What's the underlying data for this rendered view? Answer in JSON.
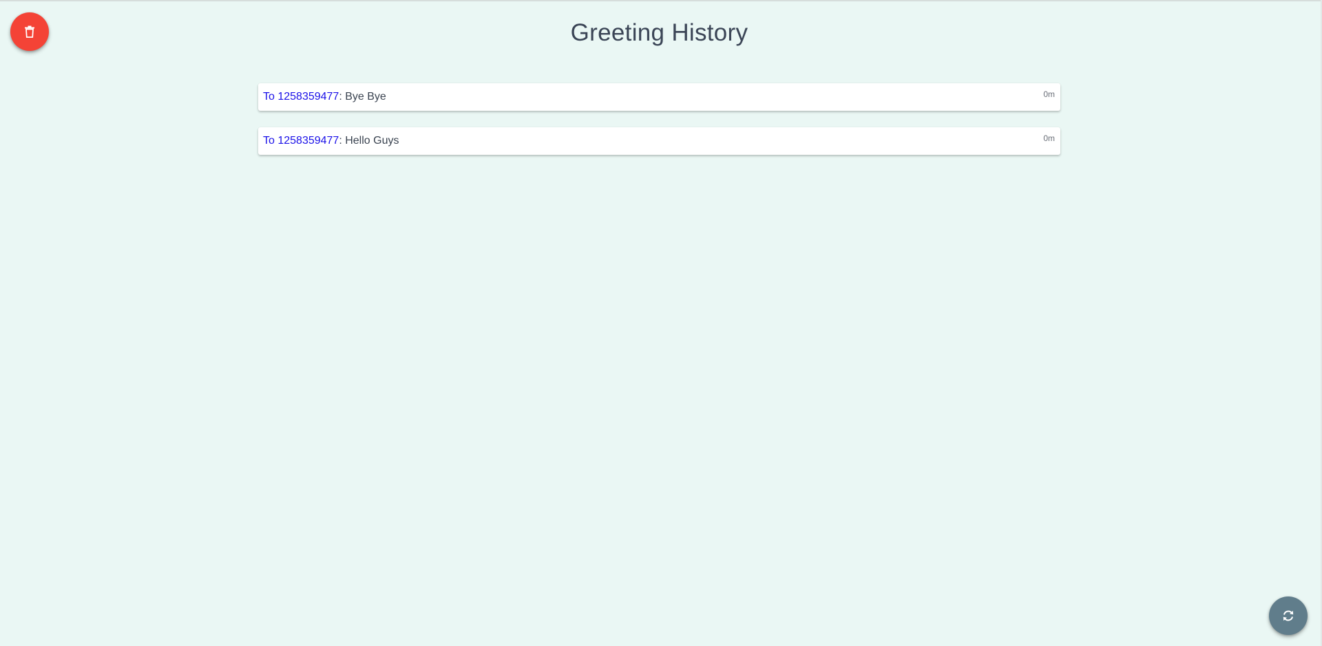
{
  "page": {
    "title": "Greeting History"
  },
  "history": [
    {
      "recipient": "To 1258359477",
      "separator": ": ",
      "message": "Bye Bye",
      "time": "0m"
    },
    {
      "recipient": "To 1258359477",
      "separator": ": ",
      "message": "Hello Guys",
      "time": "0m"
    }
  ],
  "actions": {
    "delete_icon": "trash-icon",
    "refresh_icon": "refresh-icon"
  },
  "colors": {
    "background": "#eaf7f4",
    "delete_button": "#f44336",
    "refresh_button": "#607d8b",
    "recipient_link": "#1a10e8"
  }
}
